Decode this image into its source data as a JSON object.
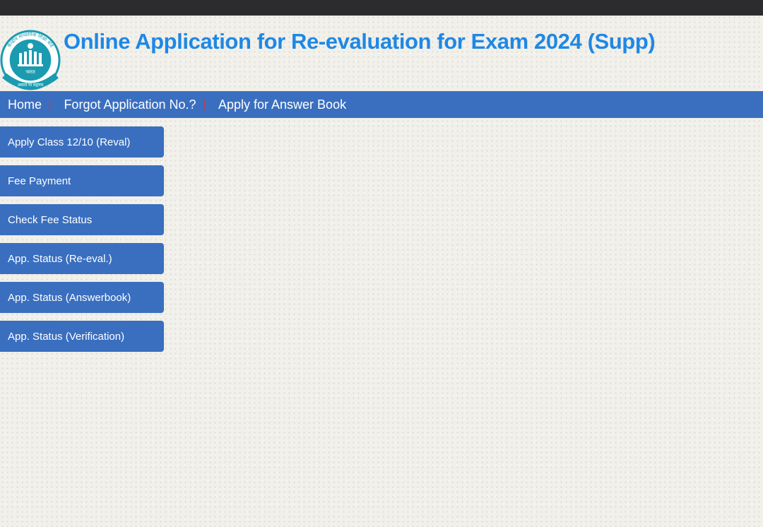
{
  "header": {
    "title": "Online Application for Re-evaluation for Exam 2024 (Supp)",
    "logo": {
      "icon": "cbse-emblem-icon",
      "outer_text": "केन्द्रीय माध्यमिक शिक्षा बोर्ड",
      "inner_text": "भारत",
      "motto": "असतो मा सद्गमय",
      "color": "#1a9bb0"
    }
  },
  "nav": {
    "items": [
      {
        "label": "Home"
      },
      {
        "label": "Forgot Application No.?"
      },
      {
        "label": "Apply for Answer Book"
      }
    ],
    "separator": "|",
    "separator_color": "#e03030",
    "background": "#3a6fc0"
  },
  "sidebar": {
    "items": [
      {
        "label": "Apply Class 12/10 (Reval)"
      },
      {
        "label": "Fee Payment"
      },
      {
        "label": "Check Fee Status"
      },
      {
        "label": "App. Status (Re-eval.)"
      },
      {
        "label": "App. Status (Answerbook)"
      },
      {
        "label": "App. Status (Verification)"
      }
    ]
  },
  "colors": {
    "title": "#1e88e5",
    "topbar": "#2c2c2e",
    "page_background": "#f1f0ea"
  }
}
